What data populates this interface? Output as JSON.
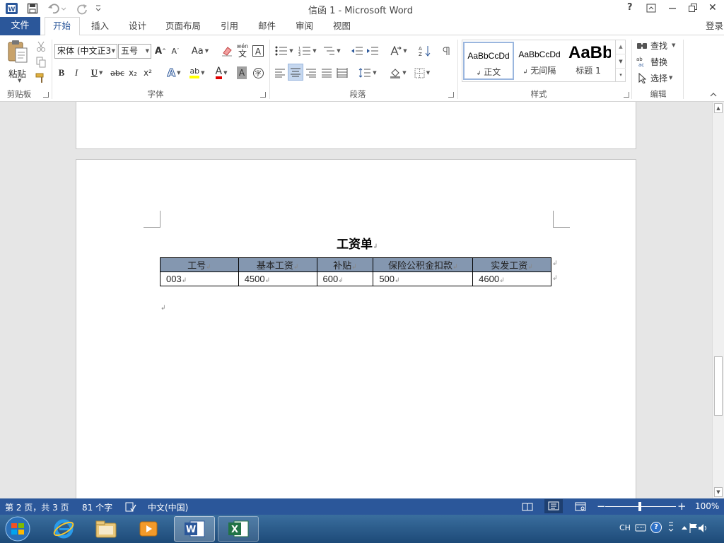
{
  "title_bar": {
    "title": "信函 1 - Microsoft Word",
    "help": "?",
    "close": "✕"
  },
  "tabs": {
    "file": "文件",
    "items": [
      "开始",
      "插入",
      "设计",
      "页面布局",
      "引用",
      "邮件",
      "审阅",
      "视图"
    ],
    "active": "开始",
    "login": "登录"
  },
  "ribbon": {
    "clipboard": {
      "paste": "粘贴",
      "group": "剪贴板"
    },
    "font": {
      "font_name": "宋体 (中文正3",
      "font_size": "五号",
      "change_case": "Aa",
      "phonetic": "wén",
      "phonetic_char": "文",
      "bold": "B",
      "italic": "I",
      "underline": "U",
      "strike": "abc",
      "sub": "x₂",
      "sup": "x²",
      "text_effect": "A",
      "highlight": "ab",
      "font_color": "A",
      "char_shade": "A",
      "enclose": "字",
      "group": "字体"
    },
    "paragraph": {
      "group": "段落"
    },
    "styles": {
      "cards": [
        {
          "preview": "AaBbCcDd",
          "name": "正文"
        },
        {
          "preview": "AaBbCcDd",
          "name": "无间隔"
        },
        {
          "preview": "AaBb",
          "name": "标题 1"
        }
      ],
      "group": "样式"
    },
    "editing": {
      "find": "查找",
      "replace": "替换",
      "select": "选择",
      "group": "编辑"
    }
  },
  "document": {
    "heading": "工资单",
    "table": {
      "headers": [
        "工号",
        "基本工资",
        "补贴",
        "保险公积金扣款",
        "实发工资"
      ],
      "rows": [
        [
          "003",
          "4500",
          "600",
          "500",
          "4600"
        ]
      ]
    },
    "colors": {
      "header_fill": "#8497b0"
    }
  },
  "status_bar": {
    "page": "第 2 页，共 3 页",
    "words": "81 个字",
    "language": "中文(中国)",
    "zoom": "100%"
  },
  "taskbar": {
    "ime": "CH"
  },
  "colors": {
    "accent": "#2b579a",
    "status_bg": "#2b579a"
  }
}
